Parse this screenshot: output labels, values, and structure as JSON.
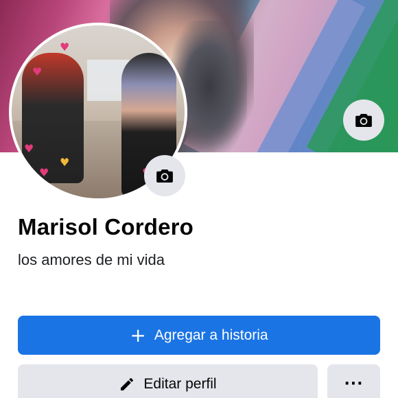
{
  "profile": {
    "name": "Marisol Cordero",
    "bio": "los amores de mi vida"
  },
  "cover": {
    "camera_icon": "camera-icon"
  },
  "avatar": {
    "camera_icon": "camera-icon"
  },
  "actions": {
    "add_story": {
      "icon": "plus-icon",
      "label": "Agregar a historia"
    },
    "edit_profile": {
      "icon": "pencil-icon",
      "label": "Editar perfil"
    },
    "more": {
      "icon": "more-icon",
      "label": "···"
    }
  },
  "colors": {
    "primary_button": "#1b74e4",
    "secondary_button": "#e4e6eb",
    "text": "#050505"
  }
}
